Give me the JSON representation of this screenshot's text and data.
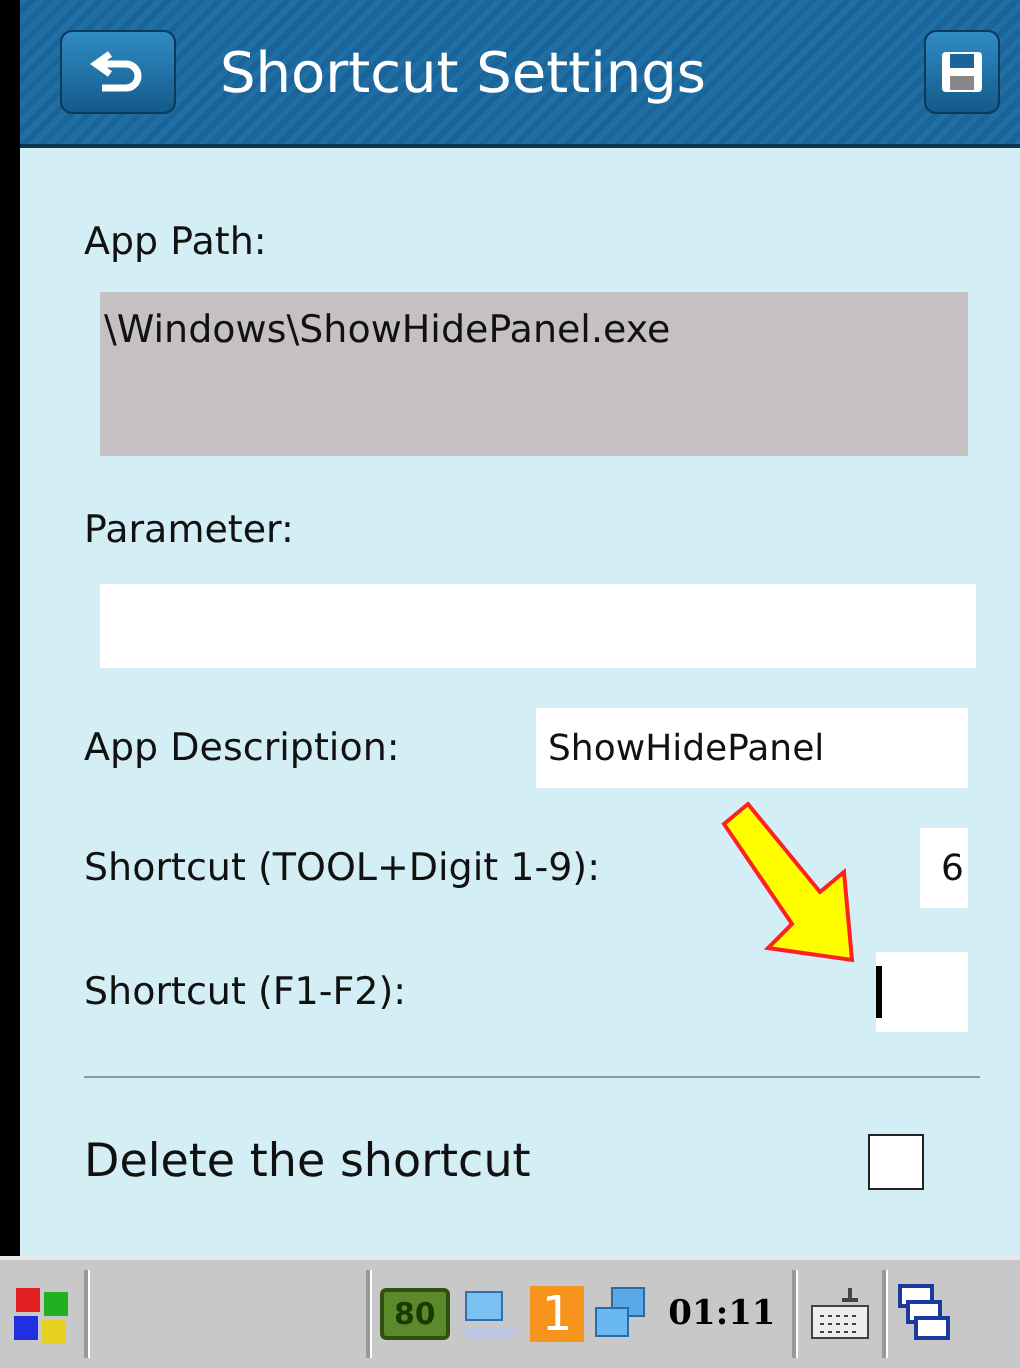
{
  "window": {
    "title": "Shortcut Settings"
  },
  "form": {
    "app_path": {
      "label": "App Path:",
      "value": "\\Windows\\ShowHidePanel.exe",
      "disabled": true
    },
    "parameter": {
      "label": "Parameter:"
    },
    "rows": [
      {
        "label": "App Description:",
        "value": "ShowHidePanel",
        "focused": false
      },
      {
        "label": "Shortcut (TOOL+Digit 1-9):",
        "value": "6",
        "focused": false
      },
      {
        "label": "Shortcut (F1-F2):",
        "focused": true
      }
    ],
    "delete": {
      "label": "Delete the shortcut",
      "checked": false
    }
  },
  "taskbar": {
    "battery": "80",
    "notification_count": "1",
    "clock": "01:11"
  }
}
